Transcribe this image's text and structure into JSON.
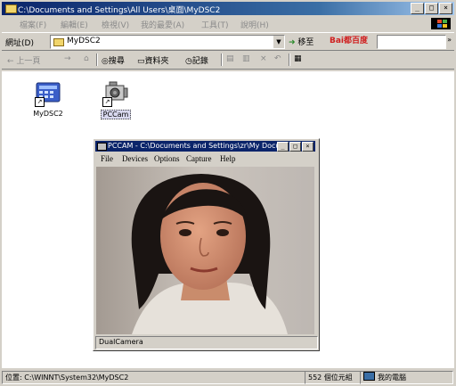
{
  "window": {
    "title": "C:\\Documents and Settings\\All Users\\桌面\\MyDSC2",
    "caption_min": "_",
    "caption_max": "□",
    "caption_close": "×"
  },
  "menu": [
    "檔案(F)",
    "編輯(E)",
    "檢視(V)",
    "我的最愛(A)",
    "工具(T)",
    "說明(H)"
  ],
  "address": {
    "label": "網址(D)",
    "value": "MyDSC2",
    "go_label": "移至",
    "search_brand": "Bai都百度",
    "more": "»"
  },
  "toolbar": {
    "back": "← 上一頁",
    "forward": "→",
    "up": "⌂",
    "search": "搜尋",
    "folders": "資料夾",
    "history": "記錄",
    "delete": "×",
    "undo": "↶",
    "views": "▦"
  },
  "desktop_icons": [
    {
      "label": "MyDSC2"
    },
    {
      "label": "PCCam"
    }
  ],
  "pccam": {
    "title": "PCCAM - C:\\Documents and Settings\\zr\\My Docu...",
    "menu": [
      "File",
      "Devices",
      "Options",
      "Capture",
      "Help"
    ],
    "status": "DualCamera"
  },
  "status": {
    "path": "位置: C:\\WINNT\\System32\\MyDSC2",
    "size": "552 個位元組",
    "zone": "我的電腦"
  },
  "colors": {
    "titlebar": "#0a246a",
    "face": "#d4d0c8",
    "window_bg": "#ffffff"
  }
}
